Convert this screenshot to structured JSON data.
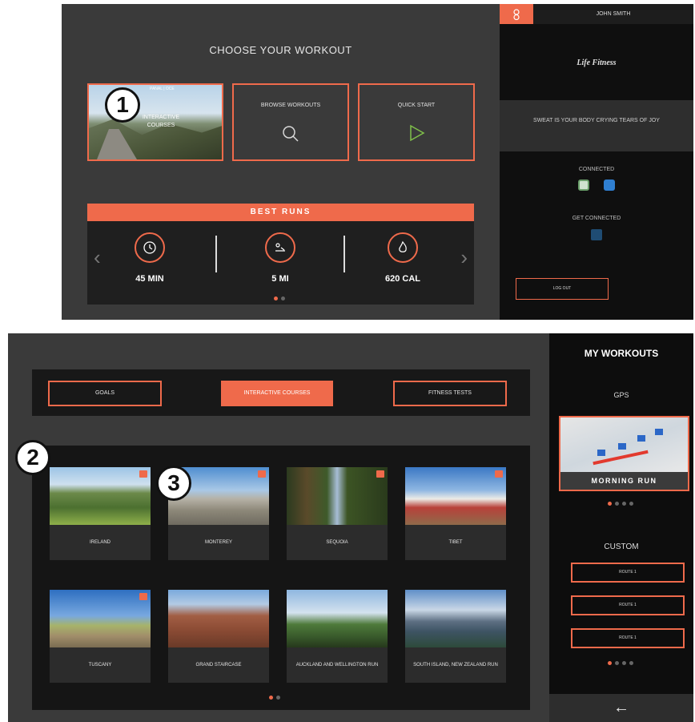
{
  "screen1": {
    "title": "CHOOSE YOUR WORKOUT",
    "cards": {
      "interactive": {
        "label": "INTERACTIVE COURSES",
        "top": "PANAL | OCE",
        "icon": "mountain-photo"
      },
      "browse": {
        "label": "BROWSE WORKOUTS",
        "icon": "search-icon"
      },
      "quick": {
        "label": "QUICK START",
        "icon": "play-icon"
      }
    },
    "best_runs": {
      "title": "BEST RUNS",
      "stats": [
        {
          "value": "45 MIN",
          "icon": "clock-icon"
        },
        {
          "value": "5 MI",
          "icon": "runner-icon"
        },
        {
          "value": "620 CAL",
          "icon": "flame-icon"
        }
      ]
    },
    "sidebar": {
      "user_name": "JOHN SMITH",
      "brand": "Life Fitness",
      "tagline": "SWEAT IS YOUR BODY CRYING TEARS OF JOY",
      "connected_label": "CONNECTED",
      "get_connected_label": "GET CONNECTED",
      "logout_label": "LOG OUT"
    }
  },
  "screen2": {
    "tabs": [
      "GOALS",
      "INTERACTIVE COURSES",
      "FITNESS TESTS"
    ],
    "courses": [
      "IRELAND",
      "MONTEREY",
      "SEQUOIA",
      "TIBET",
      "TUSCANY",
      "GRAND STAIRCASE",
      "AUCKLAND AND WELLINGTON RUN",
      "SOUTH ISLAND, NEW ZEALAND RUN"
    ],
    "sidebar": {
      "title": "MY WORKOUTS",
      "gps_label": "GPS",
      "gps_workout": "MORNING RUN",
      "custom_label": "CUSTOM",
      "routes": [
        "ROUTE 1",
        "ROUTE 1",
        "ROUTE 1"
      ],
      "back_icon": "arrow-left-icon",
      "back_glyph": "←"
    }
  },
  "badges": [
    "1",
    "2",
    "3"
  ],
  "colors": {
    "accent": "#ef6a4b",
    "panel": "#3a3a3a",
    "dark": "#0f0f0f"
  }
}
